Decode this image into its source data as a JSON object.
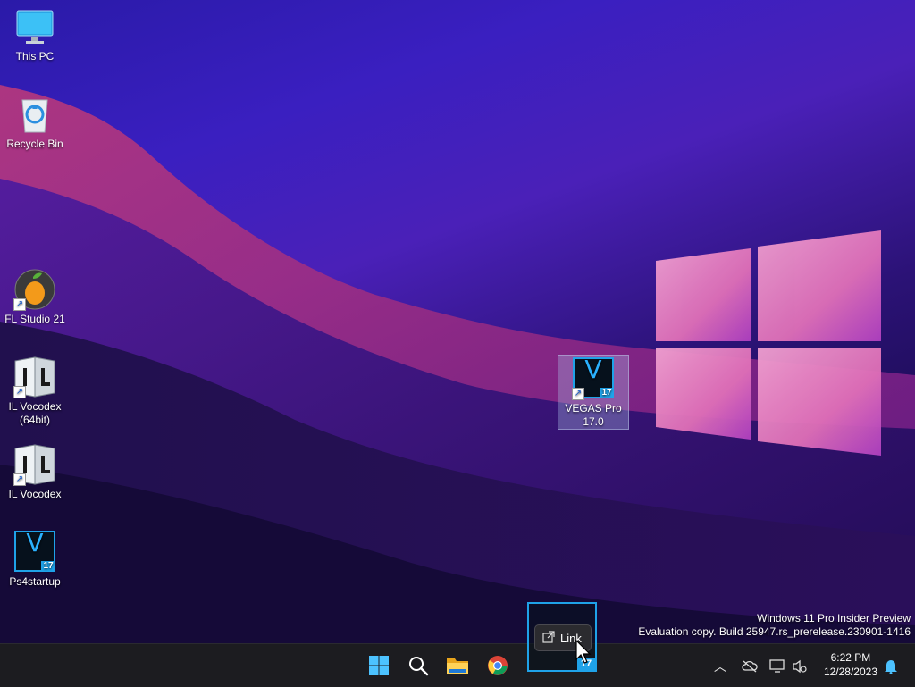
{
  "desktop": {
    "icons": [
      {
        "label": "This PC"
      },
      {
        "label": "Recycle Bin"
      },
      {
        "label": "FL Studio 21"
      },
      {
        "label": "IL Vocodex\n(64bit)"
      },
      {
        "label": "IL Vocodex"
      },
      {
        "label": "Ps4startup",
        "badge": "17",
        "glyph": "V"
      },
      {
        "label": "VEGAS Pro\n17.0",
        "badge": "17",
        "glyph": "V"
      }
    ],
    "watermark": {
      "line1": "Windows 11 Pro Insider Preview",
      "line2": "Evaluation copy. Build 25947.rs_prerelease.230901-1416"
    },
    "drag_tooltip": {
      "label": "Link",
      "badge": "17"
    }
  },
  "taskbar": {
    "apps": [
      {
        "name": "start-button"
      },
      {
        "name": "search-button"
      },
      {
        "name": "file-explorer-button"
      },
      {
        "name": "chrome-button"
      }
    ],
    "tray": {
      "time": "6:22 PM",
      "date": "12/28/2023"
    }
  },
  "colors": {
    "accent": "#1fa2e8",
    "taskbar": "#1c1c20"
  }
}
